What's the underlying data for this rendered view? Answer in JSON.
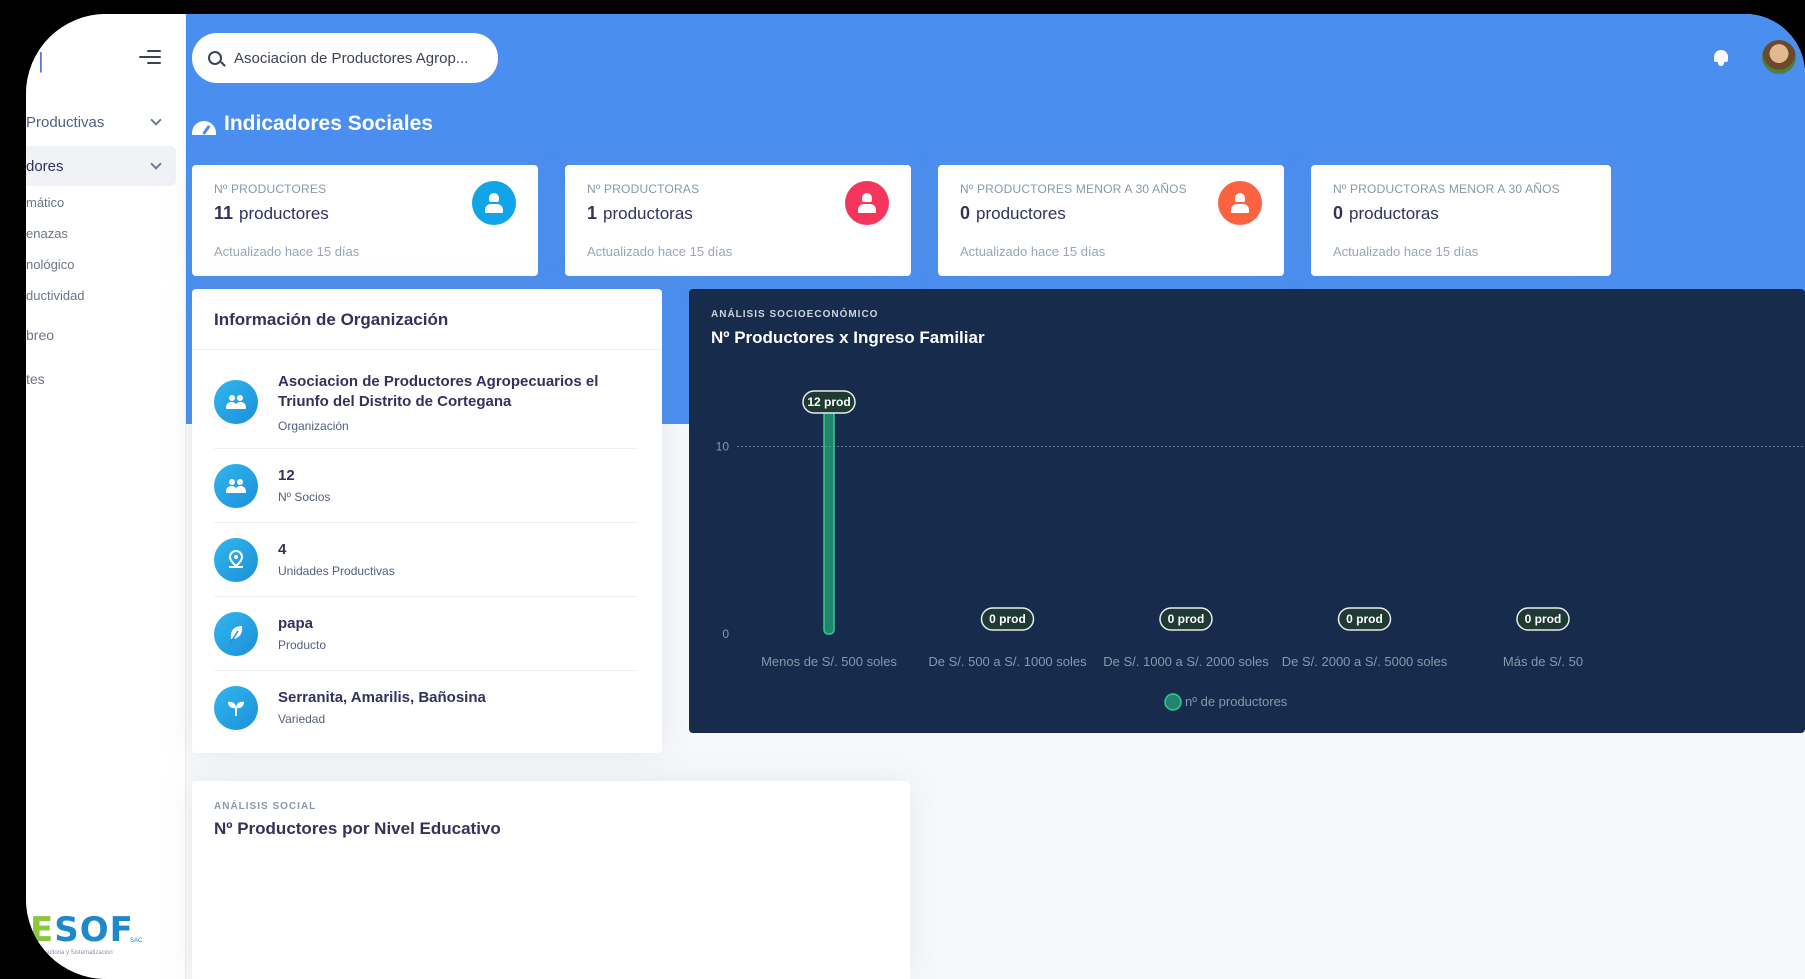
{
  "sidebar": {
    "items": [
      {
        "label": "Productivas"
      },
      {
        "label": "dores"
      }
    ],
    "subitems": [
      "mático",
      "enazas",
      "nológico",
      "ductividad"
    ],
    "links": [
      "breo",
      "tes"
    ],
    "logo": {
      "text_e": "E",
      "text_rest": "SOF",
      "sub": "Consultoria y Sistematizacion",
      "tag": "SAC"
    }
  },
  "header": {
    "search_value": "Asociacion de Productores Agrop...",
    "page_title": "Indicadores Sociales"
  },
  "stats": [
    {
      "label": "Nº PRODUCTORES",
      "value": "11",
      "unit": "productores",
      "footer": "Actualizado hace 15 días",
      "color": "#11a4e8"
    },
    {
      "label": "Nº PRODUCTORAS",
      "value": "1",
      "unit": "productoras",
      "footer": "Actualizado hace 15 días",
      "color": "#f5365c"
    },
    {
      "label": "Nº PRODUCTORES MENOR A 30 AÑOS",
      "value": "0",
      "unit": "productores",
      "footer": "Actualizado hace 15 días",
      "color": "#fb6340"
    },
    {
      "label": "Nº PRODUCTORAS MENOR A 30 AÑOS",
      "value": "0",
      "unit": "productoras",
      "footer": "Actualizado hace 15 días",
      "color": "#5e72e4"
    }
  ],
  "org": {
    "title": "Información de Organización",
    "rows": [
      {
        "main_line1": "Asociacion de Productores Agropecuarios el",
        "main_line2": "Triunfo del Distrito de Cortegana",
        "sub": "Organización",
        "icon": "users-icon"
      },
      {
        "main": "12",
        "sub": "Nº Socios",
        "icon": "users-icon"
      },
      {
        "main": "4",
        "sub": "Unidades Productivas",
        "icon": "map-pin-icon"
      },
      {
        "main": "papa",
        "sub": "Producto",
        "icon": "leaf-icon"
      },
      {
        "main": "Serranita, Amarilis, Bañosina",
        "sub": "Variedad",
        "icon": "sprout-icon"
      }
    ]
  },
  "chart_card": {
    "eyebrow": "ANÁLISIS SOCIOECONÓMICO",
    "title": "Nº Productores x Ingreso Familiar"
  },
  "chart_data": {
    "type": "bar",
    "title": "Nº Productores x Ingreso Familiar",
    "categories": [
      "Menos de S/. 500 soles",
      "De S/. 500 a S/. 1000 soles",
      "De S/. 1000 a S/. 2000 soles",
      "De S/. 2000 a S/. 5000 soles",
      "Más de S/. 50"
    ],
    "series": [
      {
        "name": "nº de productores",
        "values": [
          12,
          0,
          0,
          0,
          0
        ]
      }
    ],
    "data_labels": [
      "12 prod",
      "0 prod",
      "0 prod",
      "0 prod",
      "0 prod"
    ],
    "yticks": [
      "0",
      "10"
    ],
    "ylim": [
      0,
      12
    ],
    "grid": "dotted at 10",
    "legend": "bottom-center",
    "color": "#2dce89"
  },
  "bottom_card": {
    "eyebrow": "ANÁLISIS SOCIAL",
    "title": "Nº Productores por Nivel Educativo"
  }
}
